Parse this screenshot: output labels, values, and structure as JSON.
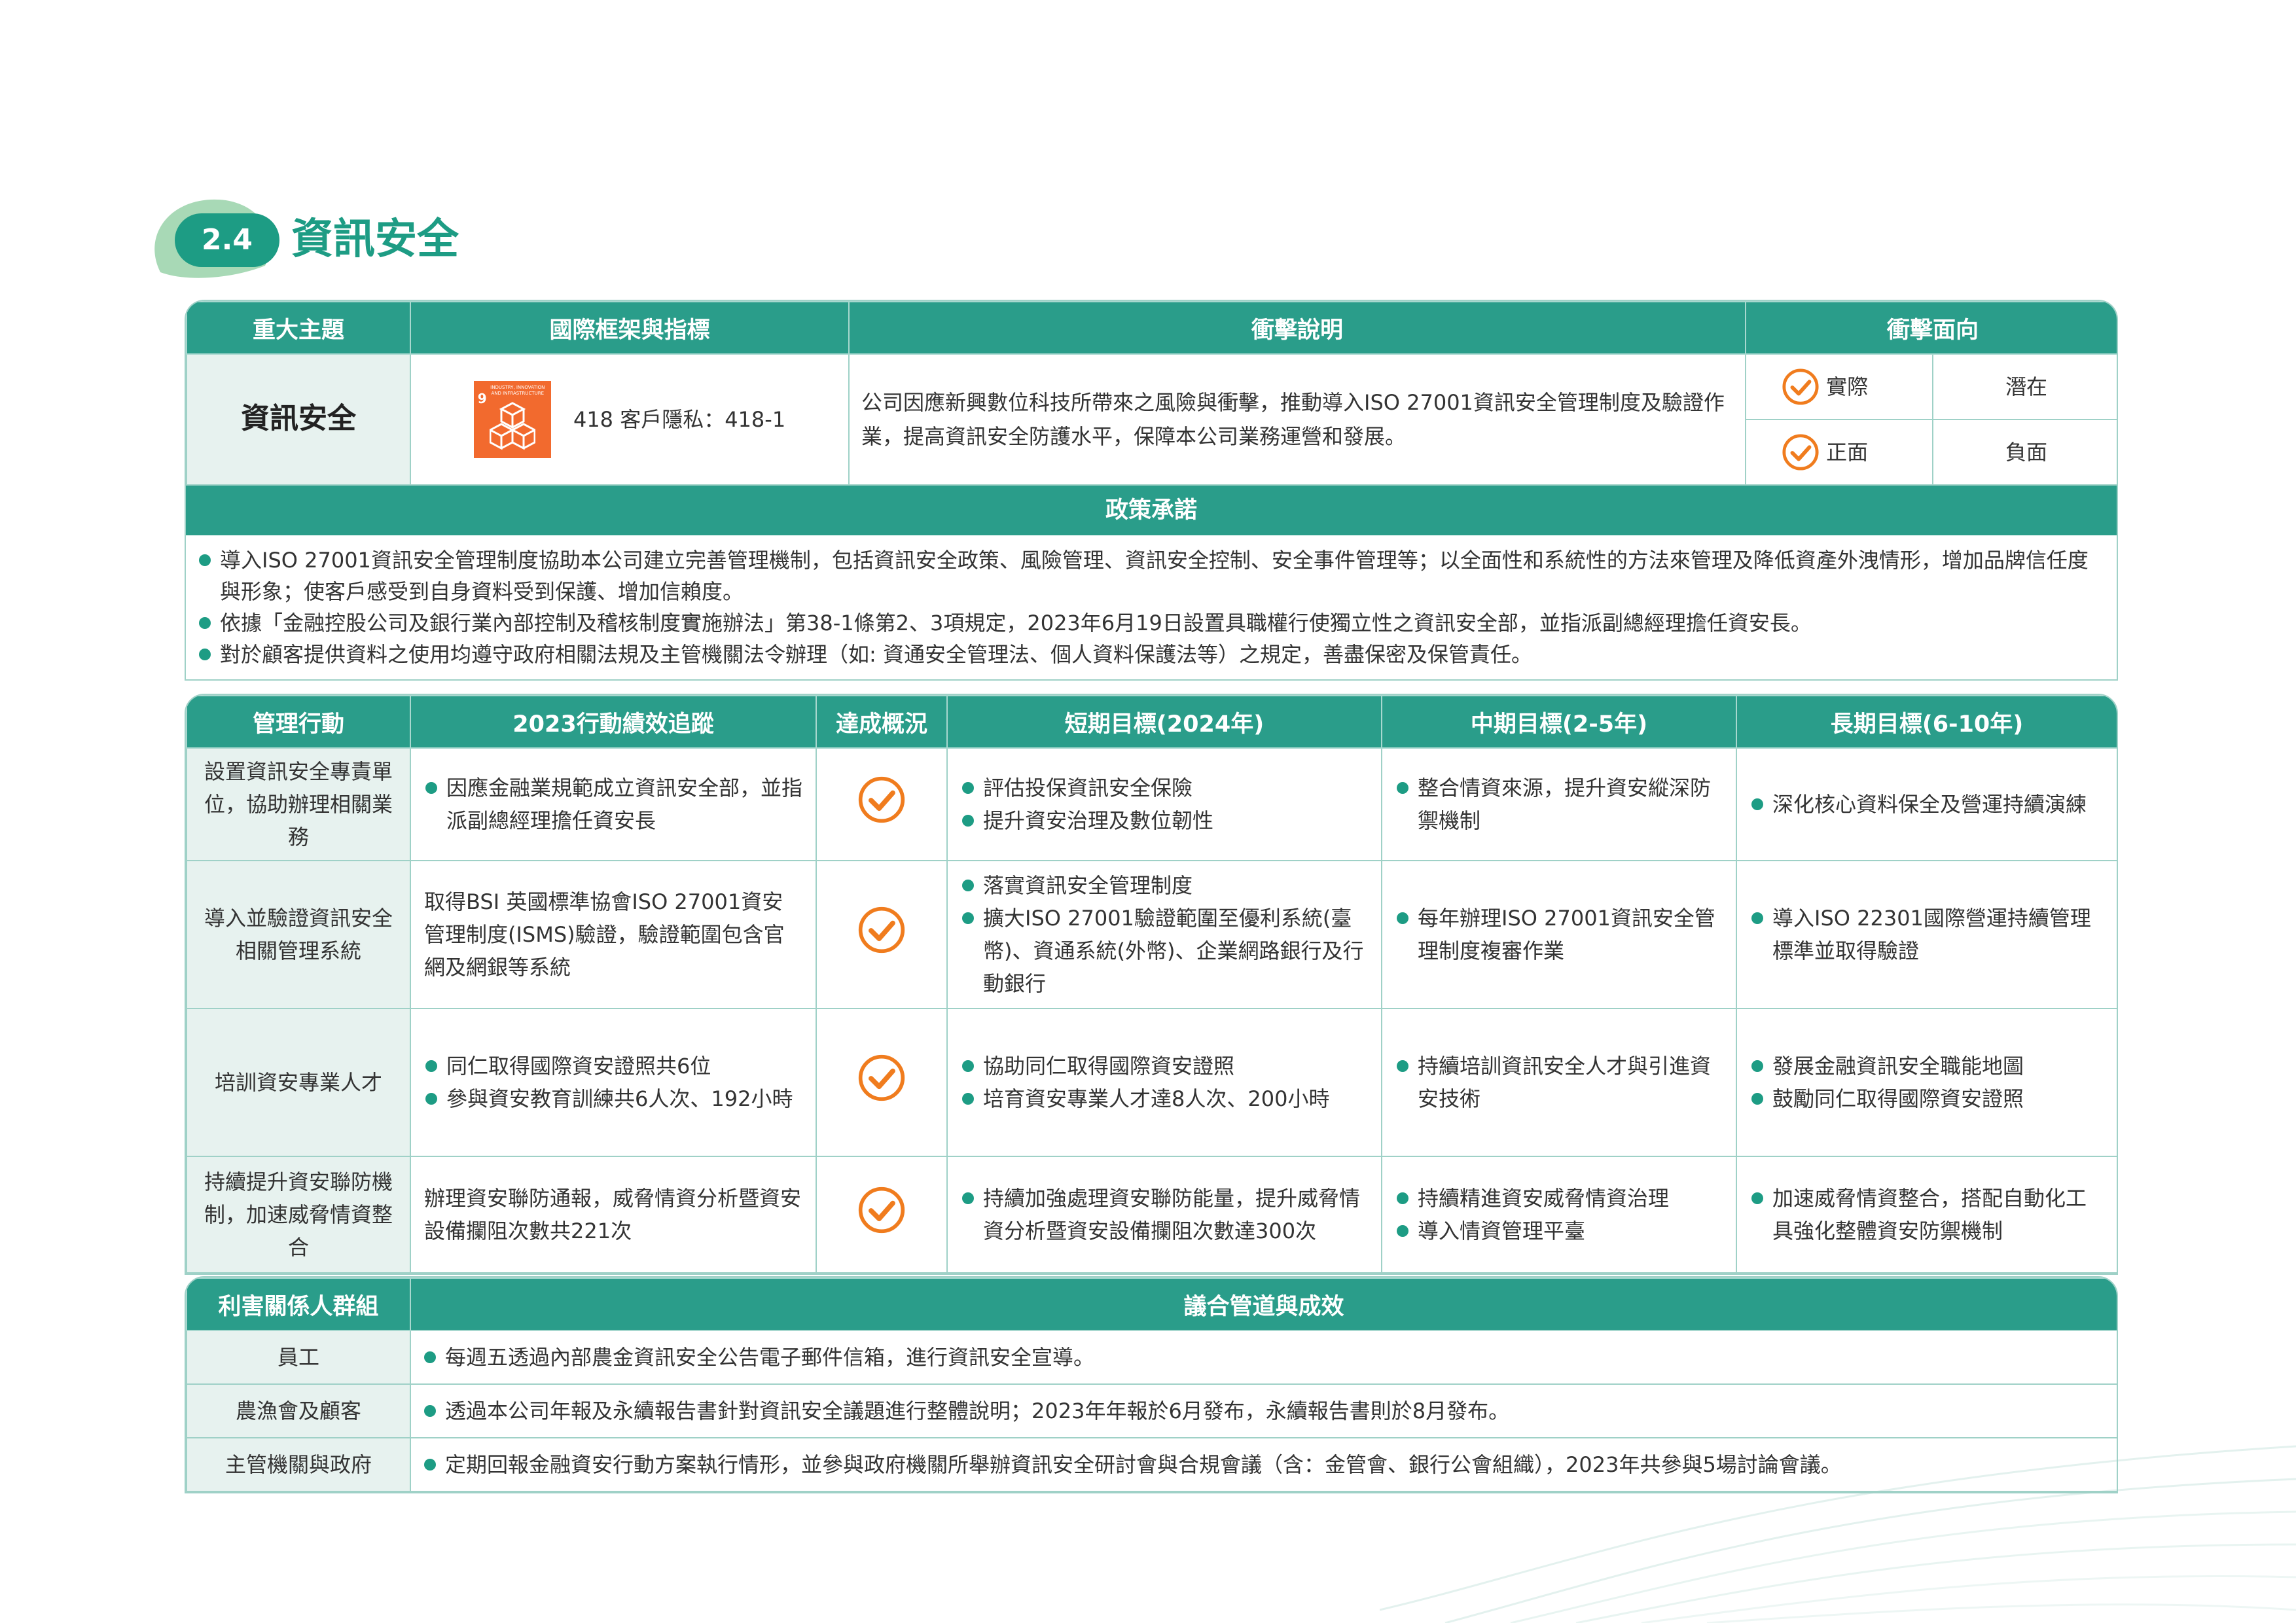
{
  "section": {
    "number": "2.4",
    "title": "資訊安全"
  },
  "topic_table": {
    "headers": [
      "重大主題",
      "國際框架與指標",
      "衝擊說明",
      "衝擊面向"
    ],
    "topic": "資訊安全",
    "sdg_number": "9",
    "sdg_text": "INDUSTRY, INNOVATION AND INFRASTRUCTURE",
    "indicator": "418 客戶隱私：418-1",
    "impact": "公司因應新興數位科技所帶來之風險與衝擊，推動導入ISO 27001資訊安全管理制度及驗證作業，提高資訊安全防護水平，保障本公司業務運營和發展。",
    "actual": "實際",
    "potential": "潛在",
    "positive": "正面",
    "negative": "負面"
  },
  "policy": {
    "title": "政策承諾",
    "items": [
      "導入ISO 27001資訊安全管理制度協助本公司建立完善管理機制，包括資訊安全政策、風險管理、資訊安全控制、安全事件管理等；以全面性和系統性的方法來管理及降低資產外洩情形，增加品牌信任度與形象；使客戶感受到自身資料受到保護、增加信賴度。",
      "依據「金融控股公司及銀行業內部控制及稽核制度實施辦法」第38-1條第2、3項規定，2023年6月19日設置具職權行使獨立性之資訊安全部，並指派副總經理擔任資安長。",
      "對於顧客提供資料之使用均遵守政府相關法規及主管機關法令辦理（如: 資通安全管理法、個人資料保護法等）之規定，善盡保密及保管責任。"
    ]
  },
  "actions_table": {
    "headers": [
      "管理行動",
      "2023行動績效追蹤",
      "達成概況",
      "短期目標(2024年)",
      "中期目標(2-5年)",
      "長期目標(6-10年)"
    ],
    "rows": [
      {
        "action": "設置資訊安全專責單位，協助辦理相關業務",
        "performance": [
          "因應金融業規範成立資訊安全部，並指派副總經理擔任資安長"
        ],
        "perf_bullet": true,
        "short": [
          "評估投保資訊安全保險",
          "提升資安治理及數位韌性"
        ],
        "mid": [
          "整合情資來源，提升資安縱深防禦機制"
        ],
        "long": [
          "深化核心資料保全及營運持續演練"
        ]
      },
      {
        "action": "導入並驗證資訊安全相關管理系統",
        "performance": [
          "取得BSI 英國標準協會ISO 27001資安管理制度(ISMS)驗證，驗證範圍包含官網及網銀等系統"
        ],
        "perf_bullet": false,
        "short": [
          "落實資訊安全管理制度",
          "擴大ISO 27001驗證範圍至優利系統(臺幣)、資通系統(外幣)、企業網路銀行及行動銀行"
        ],
        "mid": [
          "每年辦理ISO 27001資訊安全管理制度複審作業"
        ],
        "long": [
          "導入ISO 22301國際營運持續管理標準並取得驗證"
        ]
      },
      {
        "action": "培訓資安專業人才",
        "performance": [
          "同仁取得國際資安證照共6位",
          "參與資安教育訓練共6人次、192小時"
        ],
        "perf_bullet": true,
        "short": [
          "協助同仁取得國際資安證照",
          "培育資安專業人才達8人次、200小時"
        ],
        "mid": [
          "持續培訓資訊安全人才與引進資安技術"
        ],
        "long": [
          "發展金融資訊安全職能地圖",
          "鼓勵同仁取得國際資安證照"
        ]
      },
      {
        "action": "持續提升資安聯防機制，加速威脅情資整合",
        "performance": [
          "辦理資安聯防通報，威脅情資分析暨資安設備攔阻次數共221次"
        ],
        "perf_bullet": false,
        "short": [
          "持續加強處理資安聯防能量，提升威脅情資分析暨資安設備攔阻次數達300次"
        ],
        "mid": [
          "持續精進資安威脅情資治理",
          "導入情資管理平臺"
        ],
        "long": [
          "加速威脅情資整合，搭配自動化工具強化整體資安防禦機制"
        ]
      }
    ]
  },
  "stakeholder_table": {
    "headers": [
      "利害關係人群組",
      "議合管道與成效"
    ],
    "rows": [
      {
        "group": "員工",
        "detail": "每週五透過內部農金資訊安全公告電子郵件信箱，進行資訊安全宣導。"
      },
      {
        "group": "農漁會及顧客",
        "detail": "透過本公司年報及永續報告書針對資訊安全議題進行整體說明；2023年年報於6月發布，永續報告書則於8月發布。"
      },
      {
        "group": "主管機關與政府",
        "detail": "定期回報金融資安行動方案執行情形，並參與政府機關所舉辦資訊安全研討會與合規會議（含：金管會、銀行公會組織），2023年共參與5場討論會議。"
      }
    ]
  },
  "colors": {
    "primary": "#2a9d8a",
    "accent_check": "#f07c1e",
    "label_bg": "#e7f2ef",
    "sdg_orange": "#f26a2e"
  }
}
